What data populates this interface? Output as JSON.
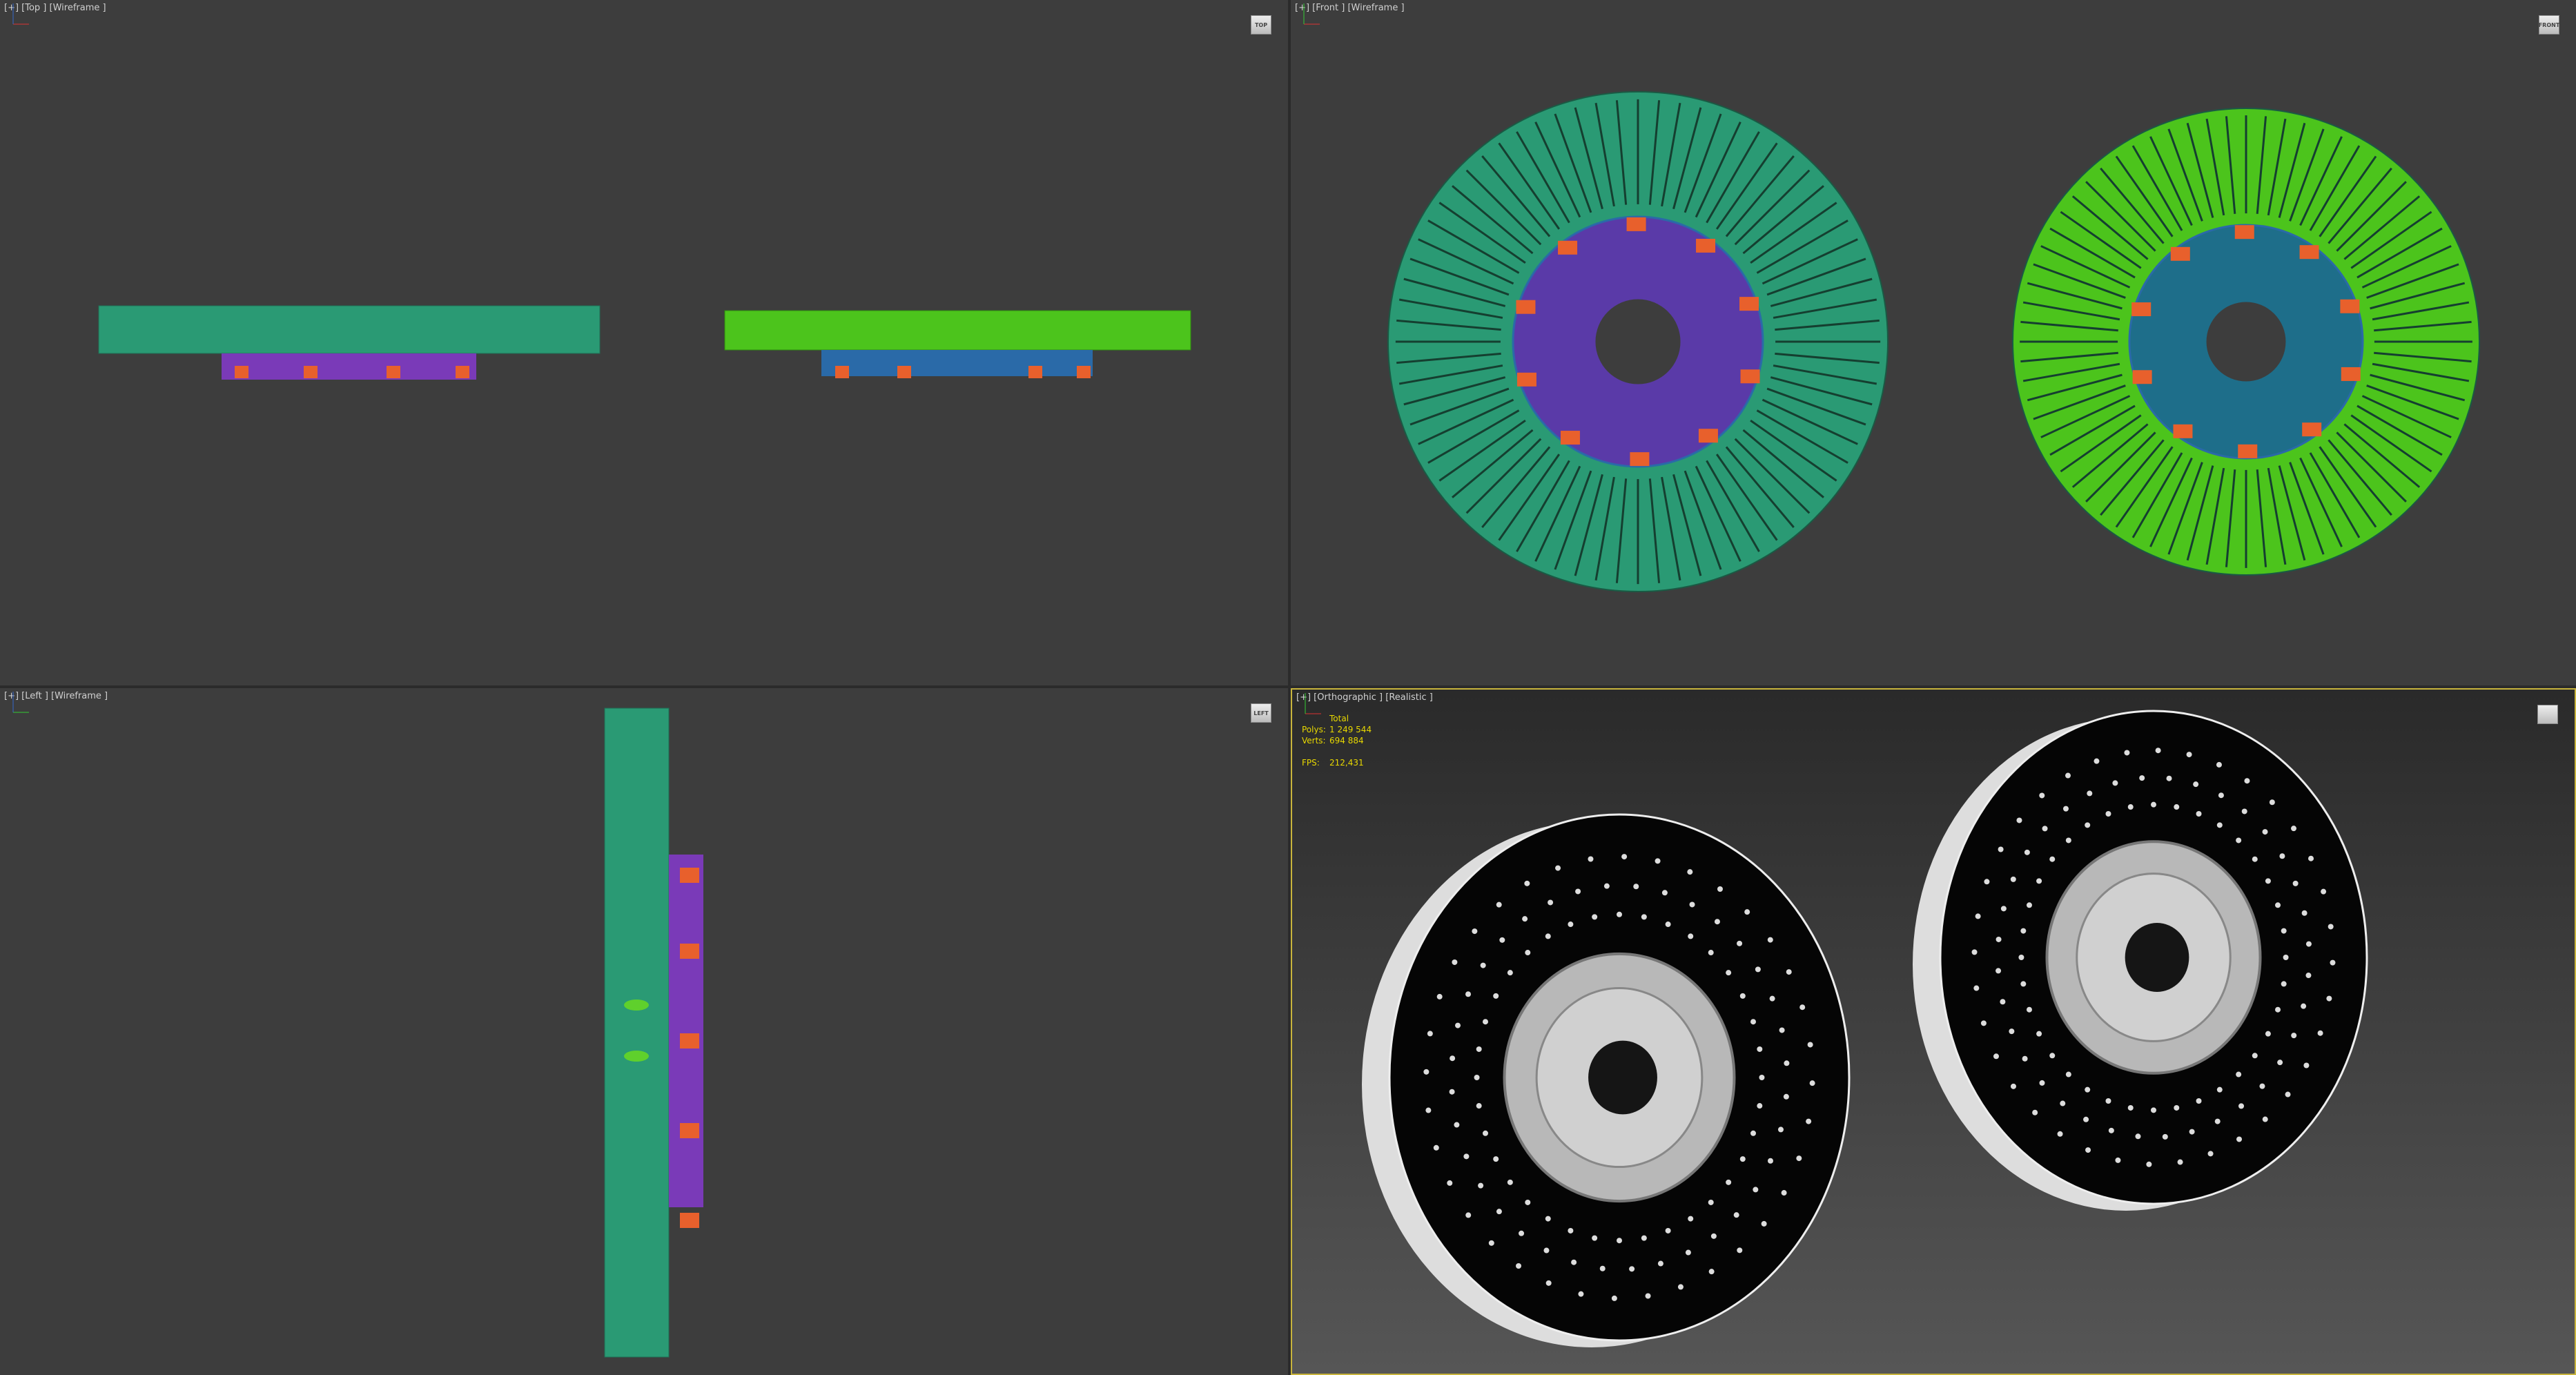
{
  "viewports": {
    "top": {
      "label": "[+] [Top ] [Wireframe ]",
      "viewcube": "TOP"
    },
    "front": {
      "label": "[+] [Front ] [Wireframe ]",
      "viewcube": "FRONT"
    },
    "left": {
      "label": "[+] [Left ] [Wireframe ]",
      "viewcube": "LEFT"
    },
    "perspective": {
      "label": "[+] [Orthographic ] [Realistic ]",
      "viewcube": "cube-icon"
    }
  },
  "stats": {
    "header": "Total",
    "polys_label": "Polys:",
    "polys": "1 249 544",
    "verts_label": "Verts:",
    "verts": "694 884",
    "fps_label": "FPS:",
    "fps": "212,431"
  },
  "colors": {
    "teal_disc": "#2a9a74",
    "green_disc": "#4cc41c",
    "caliper": "#e8602c",
    "hub": "#5a3aa8",
    "active_border": "#c8b43c"
  }
}
